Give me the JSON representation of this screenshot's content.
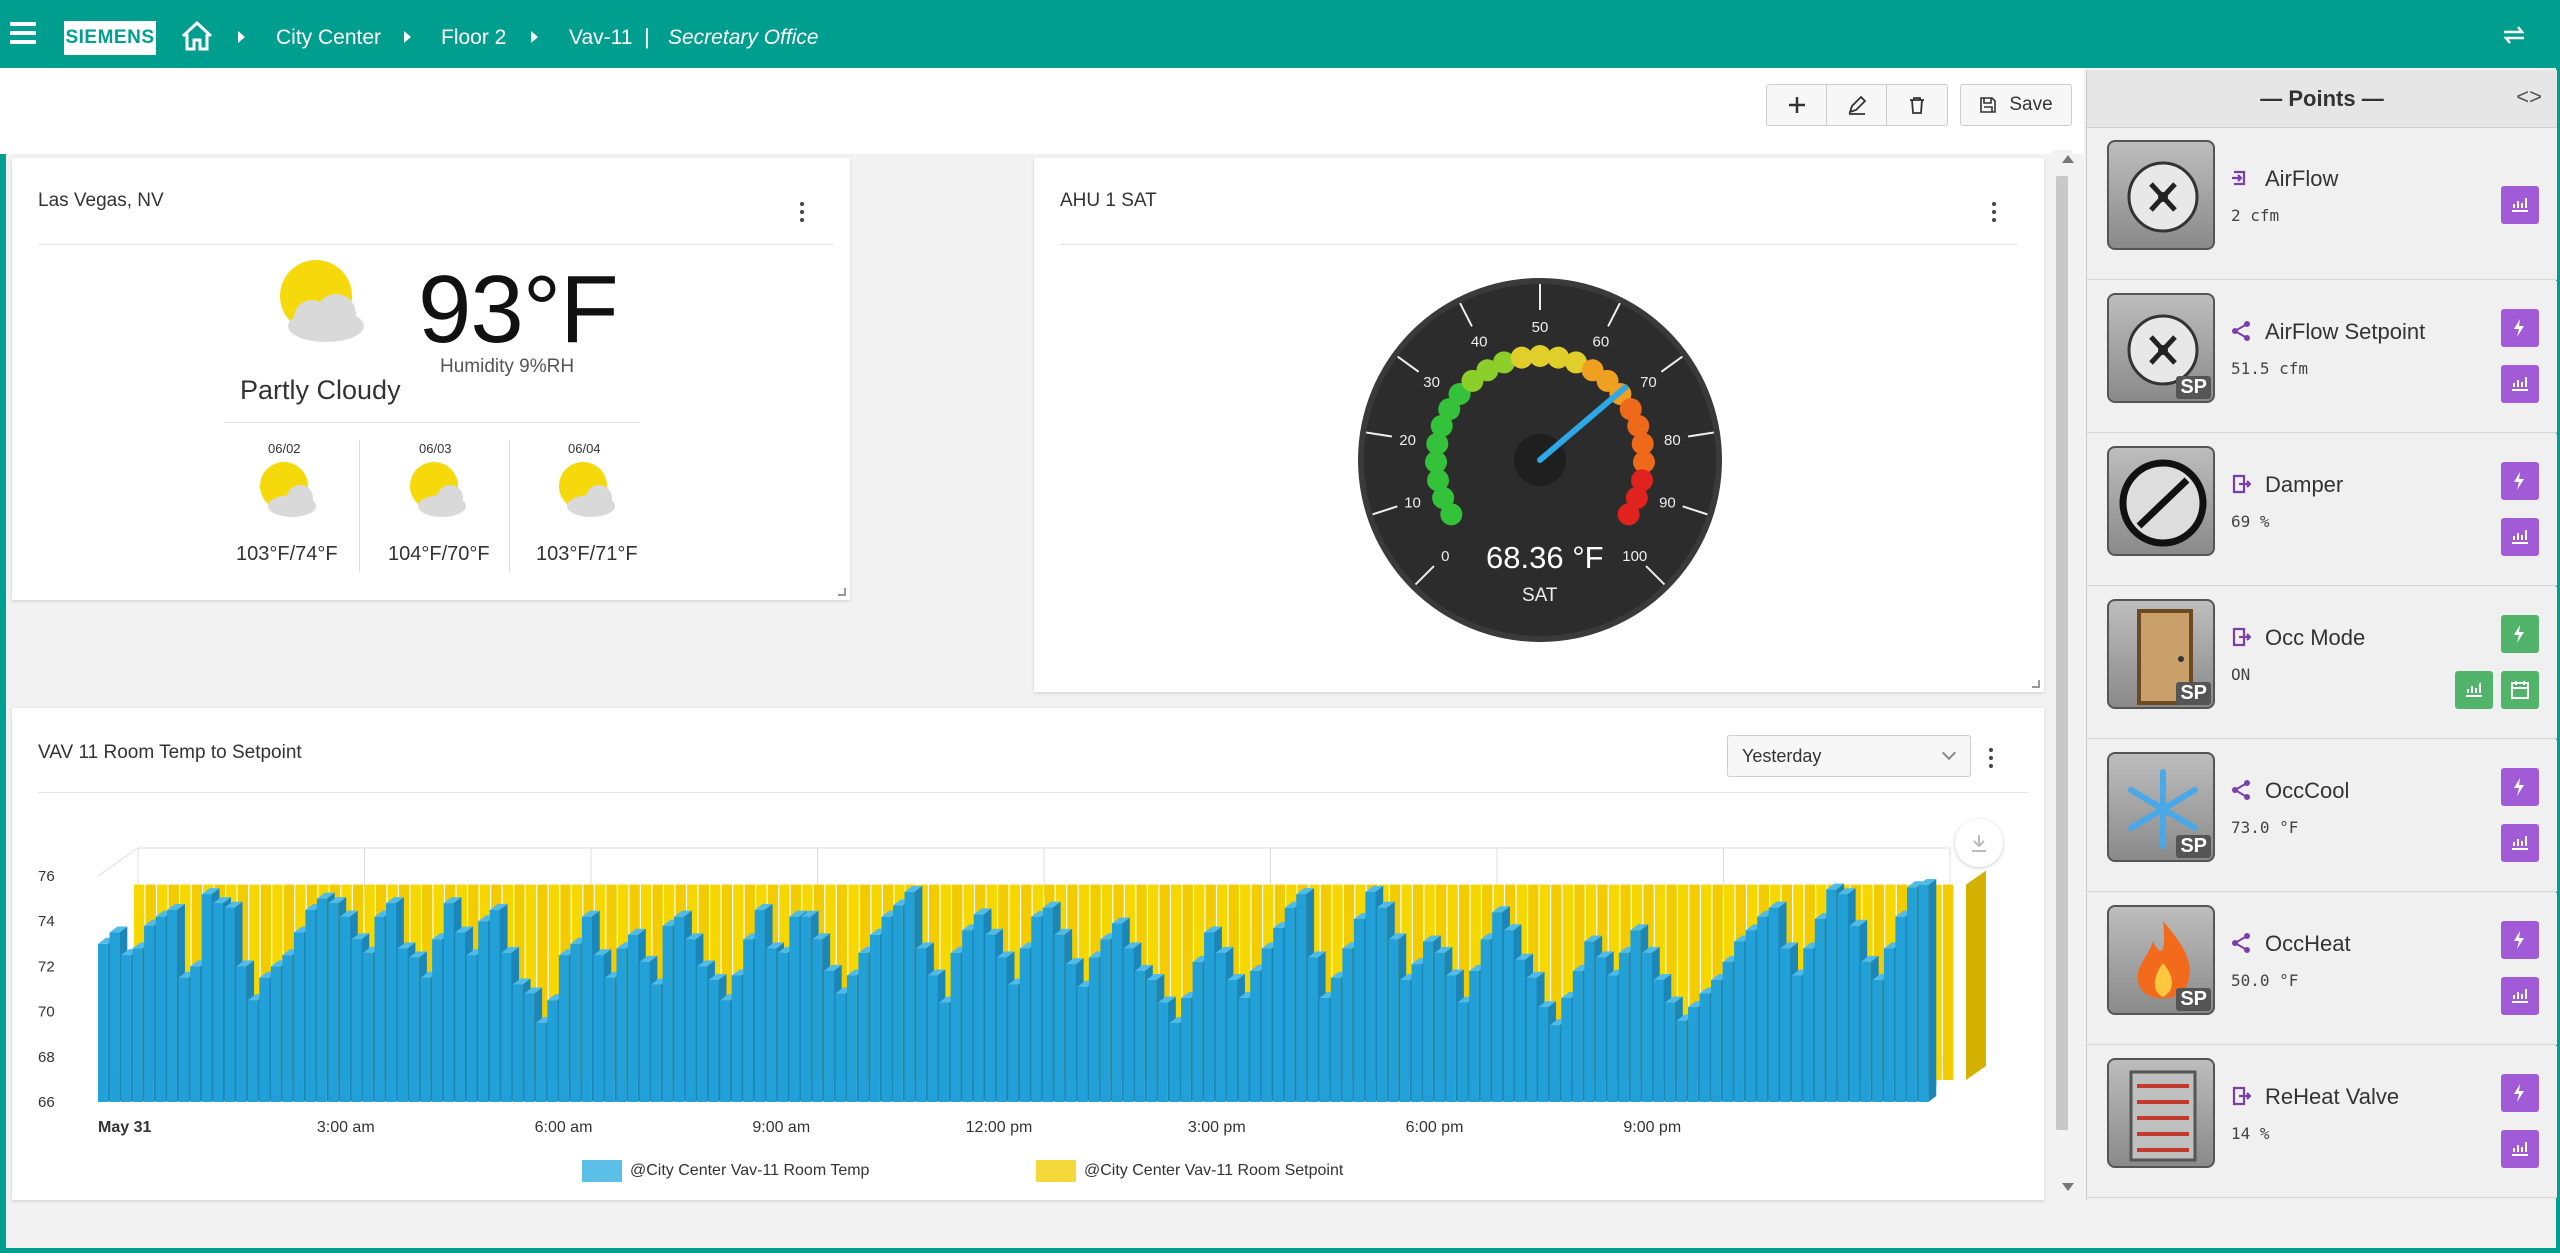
{
  "header": {
    "logo": "SIEMENS",
    "breadcrumb": [
      "City Center",
      "Floor 2",
      "Vav-11"
    ],
    "separator": "|",
    "current_location": "Secretary Office"
  },
  "toolbar": {
    "save_label": "Save"
  },
  "weather": {
    "title": "Las Vegas, NV",
    "temperature": "93°F",
    "humidity": "Humidity 9%RH",
    "condition": "Partly Cloudy",
    "forecast": [
      {
        "date": "06/02",
        "temps": "103°F/74°F"
      },
      {
        "date": "06/03",
        "temps": "104°F/70°F"
      },
      {
        "date": "06/04",
        "temps": "103°F/71°F"
      }
    ]
  },
  "gauge": {
    "title": "AHU 1 SAT",
    "value": "68.36 °F",
    "value_numeric": 68.36,
    "unit_label": "SAT",
    "min": 0,
    "max": 100,
    "ticks": [
      "0",
      "10",
      "20",
      "30",
      "40",
      "50",
      "60",
      "70",
      "80",
      "90",
      "100"
    ]
  },
  "trend": {
    "title": "VAV 11 Room Temp to Setpoint",
    "range_selector": "Yesterday"
  },
  "chart_data": {
    "type": "bar",
    "title": "VAV 11 Room Temp to Setpoint",
    "x_labels": [
      "May 31",
      "3:00 am",
      "6:00 am",
      "9:00 am",
      "12:00 pm",
      "3:00 pm",
      "6:00 pm",
      "9:00 pm"
    ],
    "y_ticks": [
      "66",
      "68",
      "70",
      "72",
      "74",
      "76"
    ],
    "ylim": [
      66,
      76
    ],
    "series": [
      {
        "name": "@City Center Vav-11 Room Temp",
        "color": "#29a3dc",
        "values": [
          73,
          73.5,
          72.5,
          72.8,
          73.8,
          74.2,
          74.5,
          71.5,
          72,
          75.2,
          74.8,
          74.6,
          72,
          70.5,
          71.5,
          72,
          72.5,
          73.5,
          74.5,
          75,
          74.8,
          74.2,
          73.2,
          72.6,
          74.2,
          74.8,
          72.8,
          72.4,
          71.5,
          73.2,
          74.8,
          73.5,
          72.5,
          74,
          74.5,
          72.6,
          71.2,
          70.8,
          69.5,
          70.5,
          72.5,
          73,
          74.2,
          72.5,
          71.5,
          72.8,
          73.4,
          72.2,
          71.2,
          73.8,
          74.2,
          73.2,
          72,
          71.4,
          70.5,
          71.6,
          73.2,
          74.5,
          72.8,
          72.6,
          74.2,
          74.2,
          73.2,
          71.8,
          70.8,
          71.6,
          72.6,
          73.4,
          74.2,
          74.7,
          75.3,
          72.8,
          71.6,
          70.4,
          72.6,
          73.6,
          74.3,
          73.4,
          72.4,
          71.2,
          72.8,
          74.2,
          74.6,
          73.4,
          72.1,
          71.1,
          72.4,
          73.2,
          73.9,
          72.8,
          71.8,
          71.4,
          70.4,
          69.5,
          70.6,
          72.2,
          73.5,
          72.6,
          71.4,
          70.6,
          71.8,
          72.8,
          73.7,
          74.6,
          75.2,
          72.4,
          70.6,
          71.5,
          72.8,
          74.1,
          75.3,
          74.6,
          73.2,
          71.4,
          72.1,
          73.1,
          72.6,
          71.6,
          70.4,
          71.8,
          73.2,
          74.4,
          73.6,
          72.3,
          71.5,
          70.2,
          69.4,
          70.6,
          71.8,
          73.1,
          72.4,
          71.6,
          72.6,
          73.6,
          72.6,
          71.4,
          70.4,
          69.6,
          70.2,
          70.8,
          71.4,
          72.2,
          73.1,
          73.6,
          74.2,
          74.6,
          72.8,
          71.6,
          72.8,
          74.1,
          75.4,
          75.2,
          73.8,
          72.2,
          71.4,
          72.8,
          74.2,
          75.5,
          75.6
        ]
      },
      {
        "name": "@City Center Vav-11 Room Setpoint",
        "color": "#f5d000",
        "values": [
          75,
          75,
          75,
          75,
          75,
          75,
          75,
          75,
          75,
          75,
          75,
          75,
          75,
          75,
          75,
          75,
          75,
          75,
          75,
          75,
          75,
          75,
          75,
          75,
          75,
          75,
          75,
          75,
          75,
          75,
          75,
          75,
          75,
          75,
          75,
          75,
          75,
          75,
          75,
          75,
          75,
          75,
          75,
          75,
          75,
          75,
          75,
          75,
          75,
          75,
          75,
          75,
          75,
          75,
          75,
          75,
          75,
          75,
          75,
          75,
          75,
          75,
          75,
          75,
          75,
          75,
          75,
          75,
          75,
          75,
          75,
          75,
          75,
          75,
          75,
          75,
          75,
          75,
          75,
          75,
          75,
          75,
          75,
          75,
          75,
          75,
          75,
          75,
          75,
          75,
          75,
          75,
          75,
          75,
          75,
          75,
          75,
          75,
          75,
          75,
          75,
          75,
          75,
          75,
          75,
          75,
          75,
          75,
          75,
          75,
          75,
          75,
          75,
          75,
          75,
          75,
          75,
          75,
          75,
          75,
          75,
          75,
          75,
          75,
          75,
          75,
          75,
          75,
          75,
          75,
          75,
          75,
          75,
          75,
          75,
          75,
          75,
          75,
          75,
          75,
          75,
          75,
          75,
          75,
          75,
          75,
          75,
          75,
          75,
          75,
          75,
          75,
          75,
          75,
          75,
          75,
          75,
          75
        ]
      }
    ],
    "legend_position": "bottom",
    "grid": true
  },
  "points_panel": {
    "title": "— Points —",
    "collapse_icon": "<>",
    "items": [
      {
        "name": "AirFlow",
        "value": "2 cfm",
        "icon": "airflow-icon",
        "setpoint": false,
        "type_icon": "input-arrow-icon",
        "buttons": [
          "trend"
        ]
      },
      {
        "name": "AirFlow Setpoint",
        "value": "51.5 cfm",
        "icon": "airflow-icon",
        "setpoint": true,
        "type_icon": "share-icon",
        "buttons": [
          "command",
          "trend"
        ]
      },
      {
        "name": "Damper",
        "value": "69 %",
        "icon": "damper-icon",
        "setpoint": false,
        "type_icon": "output-arrow-icon",
        "buttons": [
          "command",
          "trend"
        ]
      },
      {
        "name": "Occ Mode",
        "value": "ON",
        "icon": "door-icon",
        "setpoint": true,
        "type_icon": "output-arrow-icon",
        "buttons": [
          "command",
          "trend",
          "schedule"
        ]
      },
      {
        "name": "OccCool",
        "value": "73.0 °F",
        "icon": "snowflake-icon",
        "setpoint": true,
        "type_icon": "share-icon",
        "buttons": [
          "command",
          "trend"
        ]
      },
      {
        "name": "OccHeat",
        "value": "50.0 °F",
        "icon": "flame-icon",
        "setpoint": true,
        "type_icon": "share-icon",
        "buttons": [
          "command",
          "trend"
        ]
      },
      {
        "name": "ReHeat Valve",
        "value": "14 %",
        "icon": "heater-icon",
        "setpoint": false,
        "type_icon": "output-arrow-icon",
        "buttons": [
          "command",
          "trend"
        ]
      }
    ],
    "sp_label": "SP"
  },
  "colors": {
    "brand": "#009e8f",
    "command_button": "#a25bd6",
    "command_button_active": "#52b36a",
    "temp_series": "#29a3dc",
    "setpoint_series": "#f5d000"
  }
}
